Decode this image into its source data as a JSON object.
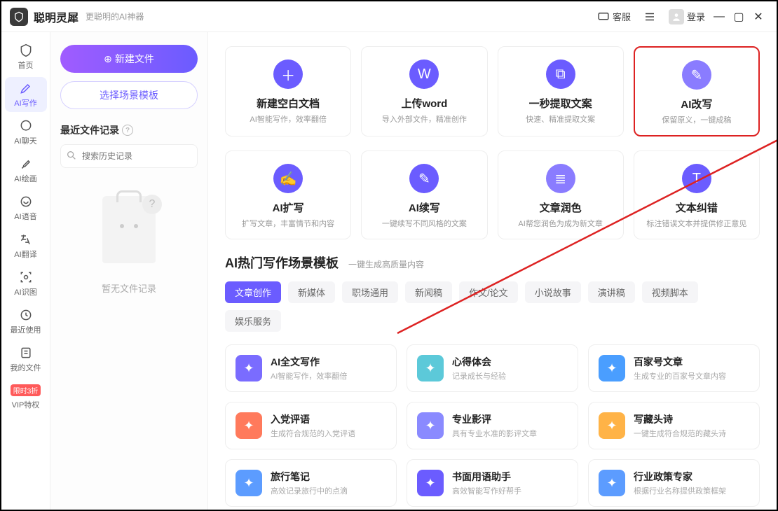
{
  "titlebar": {
    "title": "聪明灵犀",
    "subtitle": "更聪明的AI神器",
    "help_label": "客服",
    "login_label": "登录"
  },
  "sidebar": {
    "items": [
      {
        "label": "首页"
      },
      {
        "label": "AI写作"
      },
      {
        "label": "AI聊天"
      },
      {
        "label": "AI绘画"
      },
      {
        "label": "AI语音"
      },
      {
        "label": "AI翻译"
      },
      {
        "label": "AI识图"
      },
      {
        "label": "最近使用"
      },
      {
        "label": "我的文件"
      },
      {
        "label": "VIP特权"
      }
    ],
    "vip_badge": "限时3折"
  },
  "leftpanel": {
    "new_file_label": "新建文件",
    "template_label": "选择场景模板",
    "recent_label": "最近文件记录",
    "search_placeholder": "搜索历史记录",
    "empty_label": "暂无文件记录"
  },
  "features_row1": [
    {
      "title": "新建空白文档",
      "desc": "AI智能写作，效率翻倍",
      "color": "#6b5cff"
    },
    {
      "title": "上传word",
      "desc": "导入外部文件，精准创作",
      "color": "#6b5cff"
    },
    {
      "title": "一秒提取文案",
      "desc": "快速、精准提取文案",
      "color": "#6b5cff"
    },
    {
      "title": "AI改写",
      "desc": "保留原义，一键成稿",
      "color": "#8a7cff"
    }
  ],
  "features_row2": [
    {
      "title": "AI扩写",
      "desc": "扩写文章，丰富情节和内容",
      "color": "#6b5cff"
    },
    {
      "title": "AI续写",
      "desc": "一键续写不同风格的文案",
      "color": "#6b5cff"
    },
    {
      "title": "文章润色",
      "desc": "AI帮您润色为成为新文章",
      "color": "#8a7cff"
    },
    {
      "title": "文本纠错",
      "desc": "标注错误文本并提供修正意见",
      "color": "#6b5cff"
    }
  ],
  "scene_section": {
    "title": "AI热门写作场景模板",
    "subtitle": "一键生成高质量内容"
  },
  "tabs": [
    "文章创作",
    "新媒体",
    "职场通用",
    "新闻稿",
    "作文/论文",
    "小说故事",
    "演讲稿",
    "视频脚本",
    "娱乐服务"
  ],
  "templates": [
    {
      "title": "AI全文写作",
      "desc": "AI智能写作，效率翻倍",
      "color": "#7a6cff"
    },
    {
      "title": "心得体会",
      "desc": "记录成长与经验",
      "color": "#5cc9d9"
    },
    {
      "title": "百家号文章",
      "desc": "生成专业的百家号文章内容",
      "color": "#4a9eff"
    },
    {
      "title": "入党评语",
      "desc": "生成符合规范的入党评语",
      "color": "#ff7a5c"
    },
    {
      "title": "专业影评",
      "desc": "具有专业水准的影评文章",
      "color": "#8a8aff"
    },
    {
      "title": "写藏头诗",
      "desc": "一键生成符合规范的藏头诗",
      "color": "#ffb347"
    },
    {
      "title": "旅行笔记",
      "desc": "高效记录旅行中的点滴",
      "color": "#5c9cff"
    },
    {
      "title": "书面用语助手",
      "desc": "高效智能写作好帮手",
      "color": "#6b5cff"
    },
    {
      "title": "行业政策专家",
      "desc": "根据行业名称提供政策框架",
      "color": "#5c9cff"
    }
  ]
}
